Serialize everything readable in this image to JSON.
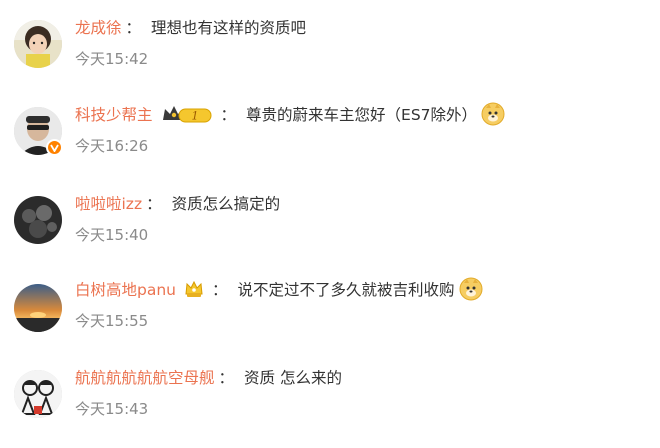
{
  "comments": [
    {
      "username": "龙成徐",
      "colon": "：",
      "text": "理想也有这样的资质吧",
      "time": "今天15:42"
    },
    {
      "username": "科技少帮主",
      "colon": "：",
      "text": "尊贵的蔚来车主您好（ES7除外）",
      "time": "今天16:26",
      "badge_number": "1"
    },
    {
      "username": "啦啦啦izz",
      "colon": "：",
      "text": "资质怎么搞定的",
      "time": "今天15:40"
    },
    {
      "username": "白树高地panu",
      "colon": "：",
      "text": "说不定过不了多久就被吉利收购",
      "time": "今天15:55"
    },
    {
      "username": "航航航航航航空母舰",
      "colon": "：",
      "text": "资质 怎么来的",
      "time": "今天15:43"
    }
  ],
  "colors": {
    "username": "#eb7350",
    "text": "#333333",
    "time": "#8a8a8a",
    "verified": "#ff8200"
  },
  "icons": {
    "emoji": "doge-emoji-icon",
    "verified": "verified-v-icon",
    "crown": "crown-badge-icon",
    "membership": "membership-badge-icon"
  }
}
